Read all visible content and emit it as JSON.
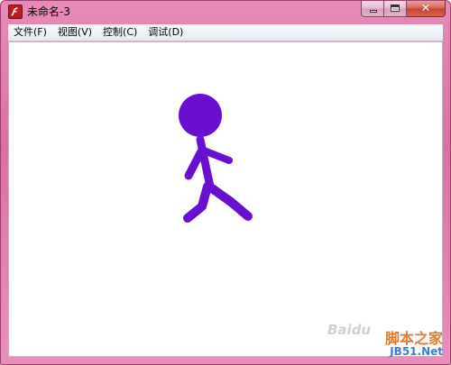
{
  "window": {
    "title": "未命名-3",
    "close_glyph": "✕"
  },
  "menu": {
    "items": [
      {
        "label": "文件(F)"
      },
      {
        "label": "视图(V)"
      },
      {
        "label": "控制(C)"
      },
      {
        "label": "调试(D)"
      }
    ]
  },
  "stage": {
    "figure_color": "#6a0fd0"
  },
  "watermark": {
    "baidu": "Baidu",
    "site_name": "脚本之家",
    "site_url": "JB51.Net"
  },
  "colors": {
    "title_bar": "#dc70a6",
    "close_button": "#c7402c"
  },
  "icons": [
    "flash-player-icon",
    "minimize-icon",
    "maximize-icon",
    "close-icon"
  ]
}
